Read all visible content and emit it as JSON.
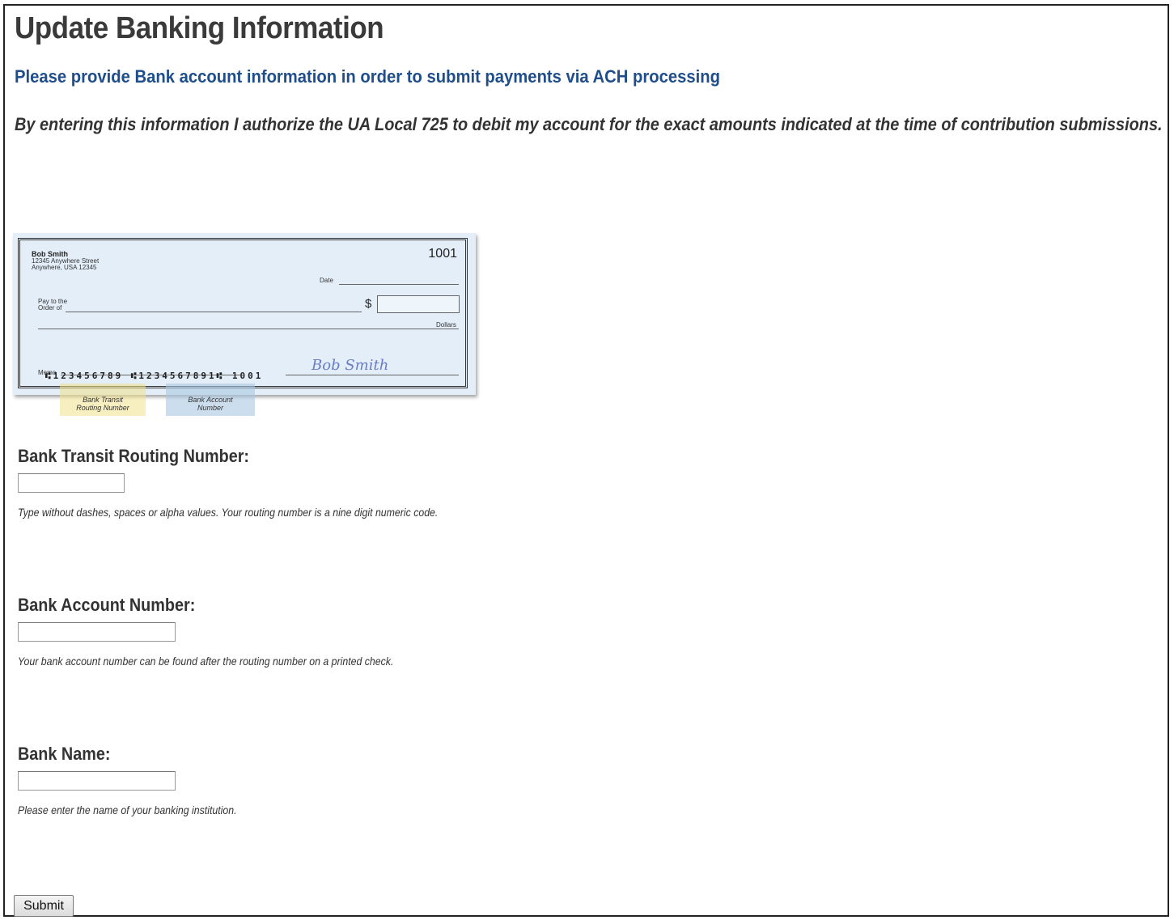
{
  "page": {
    "title": "Update Banking Information",
    "subtitle": "Please provide Bank account information in order to submit payments via ACH processing",
    "authorization": "By entering this information I authorize the UA Local 725 to debit my account for the exact amounts indicated at the time of contribution submissions."
  },
  "check": {
    "name": "Bob Smith",
    "address_line1": "12345 Anywhere Street",
    "address_line2": "Anywhere, USA 12345",
    "check_number": "1001",
    "date_label": "Date",
    "pay_to_line1": "Pay to the",
    "pay_to_line2": "Order of",
    "dollar_sign": "$",
    "dollars_label": "Dollars",
    "memo_label": "Memo",
    "signature": "Bob Smith",
    "micr": "⑆123456789 ⑆1234567891⑆ 1001",
    "routing_tag_line1": "Bank Transit",
    "routing_tag_line2": "Routing Number",
    "account_tag_line1": "Bank Account",
    "account_tag_line2": "Number"
  },
  "form": {
    "routing": {
      "label": "Bank Transit Routing Number:",
      "value": "",
      "hint": "Type without dashes, spaces or alpha values. Your routing number is a nine digit numeric code."
    },
    "account": {
      "label": "Bank Account Number:",
      "value": "",
      "hint": "Your bank account number can be found after the routing number on a printed check."
    },
    "bank_name": {
      "label": "Bank Name:",
      "value": "",
      "hint": "Please enter the name of your banking institution."
    },
    "submit_label": "Submit"
  }
}
